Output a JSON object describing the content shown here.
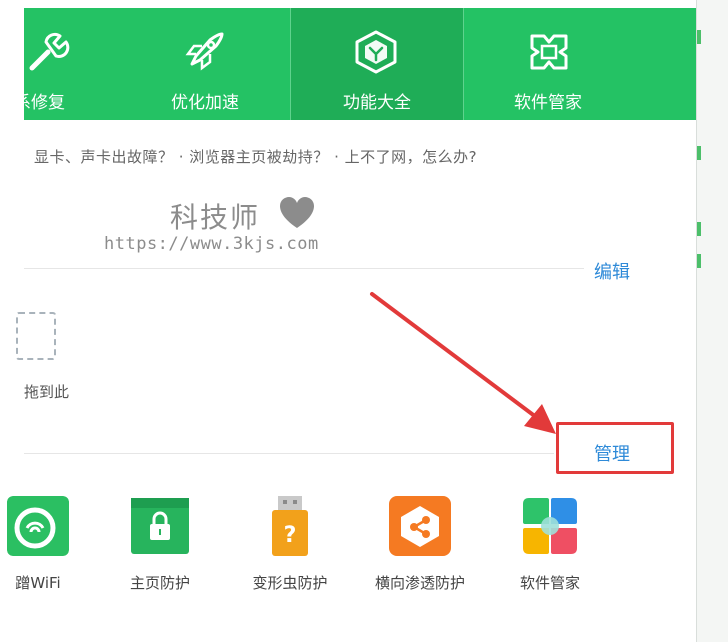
{
  "nav": {
    "items": [
      {
        "label": "系修复",
        "icon": "wrench-icon"
      },
      {
        "label": "优化加速",
        "icon": "rocket-icon"
      },
      {
        "label": "功能大全",
        "icon": "cube-icon"
      },
      {
        "label": "软件管家",
        "icon": "apps-icon"
      }
    ]
  },
  "questions": "显卡、声卡出故障？ · 浏览器主页被劫持？ · 上不了网，怎么办?",
  "watermark": {
    "name": "科技师",
    "url": "https://www.3kjs.com"
  },
  "edit_label": "编辑",
  "drag_hint": "拖到此",
  "manage_label": "管理",
  "tools": [
    {
      "label": "蹭WiFi",
      "icon": "wifi-icon"
    },
    {
      "label": "主页防护",
      "icon": "lock-browser-icon"
    },
    {
      "label": "变形虫防护",
      "icon": "usb-question-icon"
    },
    {
      "label": "横向渗透防护",
      "icon": "network-share-icon"
    },
    {
      "label": "软件管家",
      "icon": "petals-icon"
    }
  ],
  "colors": {
    "green": "#24c264",
    "link": "#2e8ad8",
    "highlight": "#e23a3a"
  }
}
